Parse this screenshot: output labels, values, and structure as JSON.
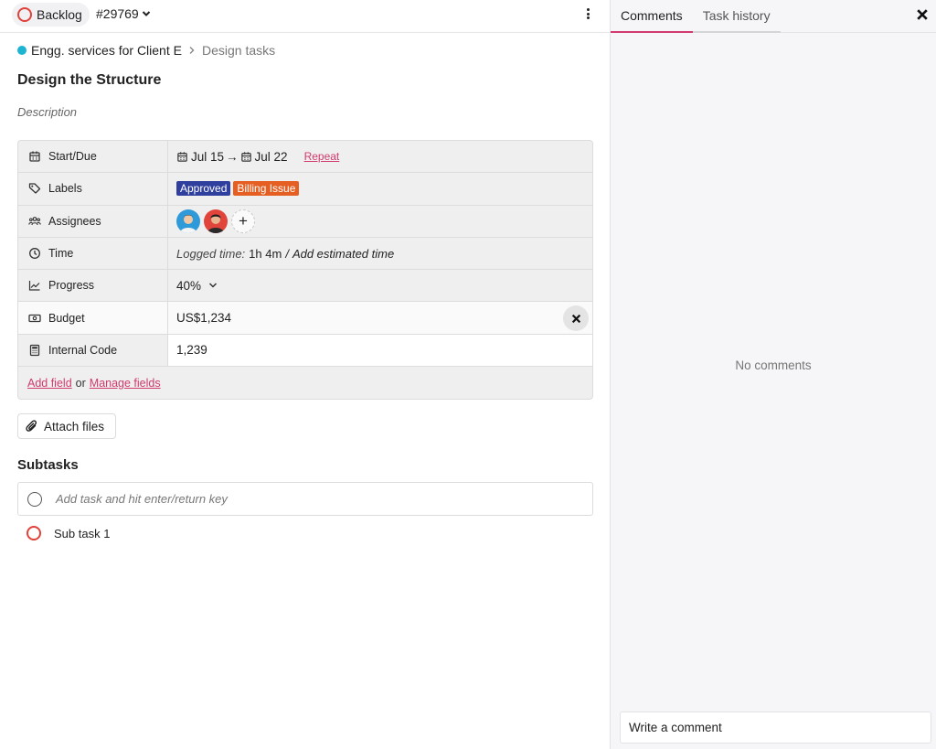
{
  "header": {
    "status": "Backlog",
    "task_id": "#29769"
  },
  "breadcrumb": {
    "project": "Engg. services for Client E",
    "section": "Design tasks",
    "project_color": "#1db4d1"
  },
  "task": {
    "title": "Design the Structure",
    "description_placeholder": "Description"
  },
  "fields": {
    "start_due": {
      "label": "Start/Due",
      "start": "Jul 15",
      "arrow": "→",
      "due": "Jul 22",
      "repeat": "Repeat"
    },
    "labels": {
      "label": "Labels",
      "items": [
        {
          "text": "Approved",
          "color": "#2e3f9e"
        },
        {
          "text": "Billing Issue",
          "color": "#e65f22"
        }
      ]
    },
    "assignees": {
      "label": "Assignees",
      "add": "+"
    },
    "time": {
      "label": "Time",
      "logged_label": "Logged time:",
      "logged_value": "1h 4m",
      "sep": "/",
      "estimate": "Add estimated time"
    },
    "progress": {
      "label": "Progress",
      "value": "40%"
    },
    "budget": {
      "label": "Budget",
      "value": "US$1,234"
    },
    "internal_code": {
      "label": "Internal Code",
      "value": "1,239"
    },
    "add_field": "Add field",
    "or": "or",
    "manage_fields": "Manage fields"
  },
  "attach": {
    "label": "Attach files"
  },
  "subtasks": {
    "heading": "Subtasks",
    "placeholder": "Add task and hit enter/return key",
    "items": [
      {
        "title": "Sub task 1"
      }
    ]
  },
  "panel": {
    "tabs": [
      {
        "label": "Comments"
      },
      {
        "label": "Task history"
      }
    ],
    "empty": "No comments",
    "comment_placeholder": "Write a comment"
  },
  "colors": {
    "accent": "#d13a6f",
    "status_backlog": "#e0413a"
  }
}
